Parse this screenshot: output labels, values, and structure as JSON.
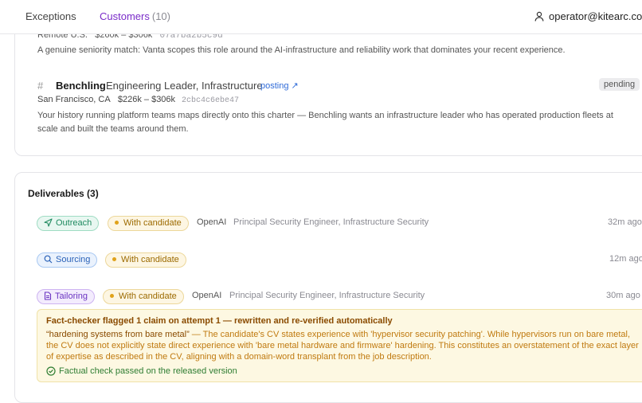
{
  "tabs": [
    {
      "label": "Exceptions"
    },
    {
      "label": "Customers",
      "count": "(10)"
    }
  ],
  "user": {
    "email": "operator@kitearc.co"
  },
  "match_prev": {
    "location": "Remote U.S.",
    "salary": "$260k – $306k",
    "id": "07a7ba2b5c9d",
    "description": "A genuine seniority match: Vanta scopes this role around the AI-infrastructure and reliability work that dominates your recent experience."
  },
  "match": {
    "hash": "#",
    "company": "Benchling",
    "role": "Engineering Leader, Infrastructure",
    "posting_label": "posting ↗",
    "status": "pending",
    "location": "San Francisco, CA",
    "salary": "$226k – $306k",
    "id": "2cbc4c6ebe47",
    "description": "Your history running platform teams maps directly onto this charter — Benchling wants an infrastructure leader who has operated production fleets at scale and built the teams around them."
  },
  "deliverables": {
    "title": "Deliverables (3)",
    "items": [
      {
        "type": "Outreach",
        "status": "With candidate",
        "company": "OpenAI",
        "role": "Principal Security Engineer, Infrastructure Security",
        "time": "32m ago"
      },
      {
        "type": "Sourcing",
        "status": "With candidate",
        "company": "",
        "role": "",
        "time": "12m ago"
      },
      {
        "type": "Tailoring",
        "status": "With candidate",
        "company": "OpenAI",
        "role": "Principal Security Engineer, Infrastructure Security",
        "time": "30m ago"
      }
    ]
  },
  "alert": {
    "title": "Fact-checker flagged 1 claim on attempt 1 — rewritten and re-verified automatically",
    "quote": "“hardening systems from bare metal”",
    "body": " — The candidate's CV states experience with 'hypervisor security patching'. While hypervisors run on bare metal, the CV does not explicitly state direct experience with 'bare metal hardware and firmware' hardening. This constitutes an overstatement of the exact layer of expertise as described in the CV, aligning with a domain-word transplant from the job description.",
    "ok": "Factual check passed on the released version"
  },
  "colors": {
    "accent": "#7a2cc9",
    "link": "#2f6bd8",
    "outreach": "#1f8a60",
    "sourcing": "#2b62b8",
    "tailoring": "#6b35c2",
    "candidate": "#9c6a00",
    "alert_bg": "#fdf8e2",
    "ok": "#2e7d32"
  }
}
